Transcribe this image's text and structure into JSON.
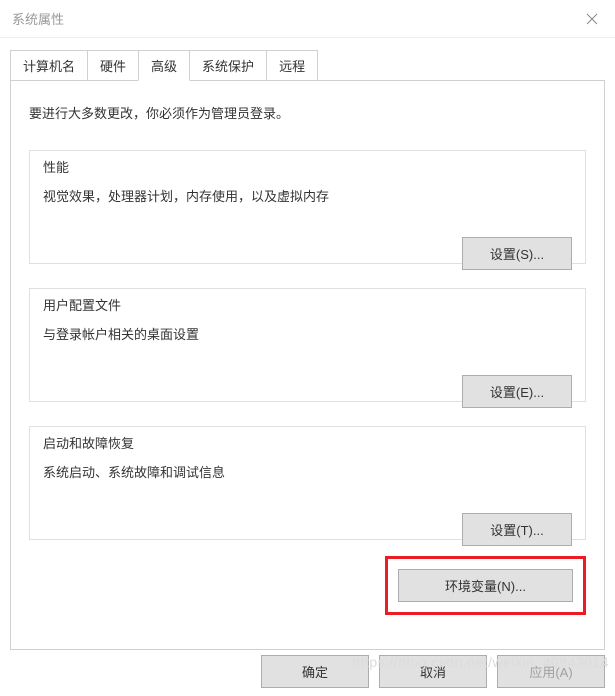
{
  "window": {
    "title": "系统属性"
  },
  "tabs": {
    "computer_name": "计算机名",
    "hardware": "硬件",
    "advanced": "高级",
    "system_protection": "系统保护",
    "remote": "远程"
  },
  "panel": {
    "intro": "要进行大多数更改，你必须作为管理员登录。",
    "performance": {
      "label": "性能",
      "desc": "视觉效果，处理器计划，内存使用，以及虚拟内存",
      "button": "设置(S)..."
    },
    "user_profiles": {
      "label": "用户配置文件",
      "desc": "与登录帐户相关的桌面设置",
      "button": "设置(E)..."
    },
    "startup": {
      "label": "启动和故障恢复",
      "desc": "系统启动、系统故障和调试信息",
      "button": "设置(T)..."
    },
    "env_vars_button": "环境变量(N)..."
  },
  "dialog_buttons": {
    "ok": "确定",
    "cancel": "取消",
    "apply": "应用(A)"
  },
  "watermark": "https://blog.csdn.net/weixin_40843614"
}
